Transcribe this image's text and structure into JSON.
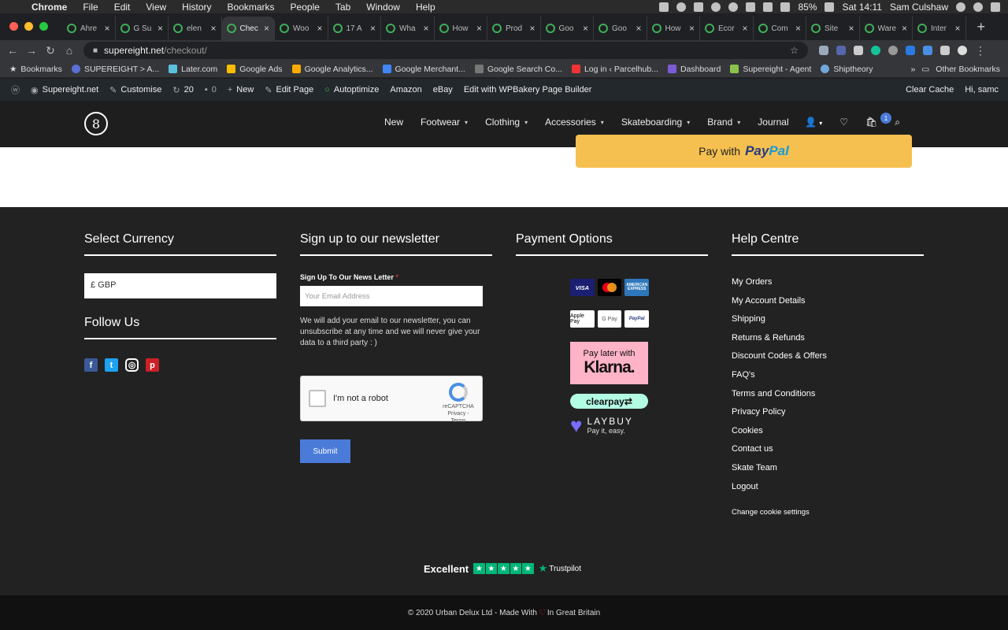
{
  "macos": {
    "app": "Chrome",
    "menu": [
      "File",
      "Edit",
      "View",
      "History",
      "Bookmarks",
      "People",
      "Tab",
      "Window",
      "Help"
    ],
    "battery": "85%",
    "clock": "Sat 14:11",
    "user": "Sam Culshaw"
  },
  "tabs": [
    {
      "label": "Ahre",
      "active": false
    },
    {
      "label": "G Su",
      "active": false
    },
    {
      "label": "elen",
      "active": false
    },
    {
      "label": "Chec",
      "active": true
    },
    {
      "label": "Woo",
      "active": false
    },
    {
      "label": "17 A",
      "active": false
    },
    {
      "label": "Wha",
      "active": false
    },
    {
      "label": "How",
      "active": false
    },
    {
      "label": "Prod",
      "active": false
    },
    {
      "label": "Goo",
      "active": false
    },
    {
      "label": "Goo",
      "active": false
    },
    {
      "label": "How",
      "active": false
    },
    {
      "label": "Ecor",
      "active": false
    },
    {
      "label": "Com",
      "active": false
    },
    {
      "label": "Site",
      "active": false
    },
    {
      "label": "Ware",
      "active": false
    },
    {
      "label": "Inter",
      "active": false
    }
  ],
  "address": {
    "host": "supereight.net",
    "path": "/checkout/"
  },
  "bookmarks": {
    "items": [
      "Bookmarks",
      "SUPEREIGHT > A...",
      "Later.com",
      "Google Ads",
      "Google Analytics...",
      "Google Merchant...",
      "Google Search Co...",
      "Log in ‹ Parcelhub...",
      "Dashboard",
      "Supereight - Agent",
      "Shiptheory"
    ],
    "more": "»",
    "other": "Other Bookmarks"
  },
  "wpbar": {
    "site": "Supereight.net",
    "customise": "Customise",
    "updates": "20",
    "comments": "0",
    "new": "New",
    "edit_page": "Edit Page",
    "autoptimize": "Autoptimize",
    "amazon": "Amazon",
    "ebay": "eBay",
    "wpbakery": "Edit with WPBakery Page Builder",
    "clear_cache": "Clear Cache",
    "greeting": "Hi, samc"
  },
  "header": {
    "logo": "8",
    "nav": [
      {
        "label": "New",
        "has_menu": false
      },
      {
        "label": "Footwear",
        "has_menu": true
      },
      {
        "label": "Clothing",
        "has_menu": true
      },
      {
        "label": "Accessories",
        "has_menu": true
      },
      {
        "label": "Skateboarding",
        "has_menu": true
      },
      {
        "label": "Brand",
        "has_menu": true
      },
      {
        "label": "Journal",
        "has_menu": false
      }
    ],
    "cart_count": "1"
  },
  "checkout": {
    "paypal_prefix": "Pay with",
    "paypal_brand_a": "Pay",
    "paypal_brand_b": "Pal"
  },
  "footer": {
    "currency": {
      "title": "Select Currency",
      "selected": "£ GBP"
    },
    "follow": {
      "title": "Follow Us",
      "networks": [
        "facebook",
        "twitter",
        "instagram",
        "pinterest"
      ]
    },
    "newsletter": {
      "title": "Sign up to our newsletter",
      "label": "Sign Up To Our News Letter",
      "required_mark": "*",
      "placeholder": "Your Email Address",
      "note": "We will add your email to our newsletter, you can unsubscribe at any time and we will never give your data to a third party : )",
      "recaptcha_label": "I'm not a robot",
      "recaptcha_brand": "reCAPTCHA",
      "recaptcha_links": "Privacy - Terms",
      "submit": "Submit"
    },
    "payment": {
      "title": "Payment Options",
      "cards": [
        "VISA",
        "mastercard",
        "AMERICAN EXPRESS"
      ],
      "wallets": [
        "Apple Pay",
        "G Pay",
        "PayPal"
      ],
      "klarna_small": "Pay later with",
      "klarna_big": "Klarna.",
      "clearpay": "clearpay⇄",
      "laybuy_name": "LAYBUY",
      "laybuy_tagline": "Pay it, easy."
    },
    "help": {
      "title": "Help Centre",
      "links": [
        "My Orders",
        "My Account Details",
        "Shipping",
        "Returns & Refunds",
        "Discount Codes & Offers",
        "FAQ's",
        "Terms and Conditions",
        "Privacy Policy",
        "Cookies",
        "Contact us",
        "Skate Team",
        "Logout"
      ],
      "cookie_settings": "Change cookie settings"
    },
    "trustpilot": {
      "rating": "Excellent",
      "brand": "Trustpilot"
    },
    "copyright_a": "© 2020 Urban Delux Ltd - Made With",
    "copyright_b": "In Great Britain"
  },
  "colors": {
    "accent": "#4a7bd8",
    "paypal": "#f5c050",
    "footer_bg": "#222222",
    "trustpilot": "#00b67a"
  }
}
